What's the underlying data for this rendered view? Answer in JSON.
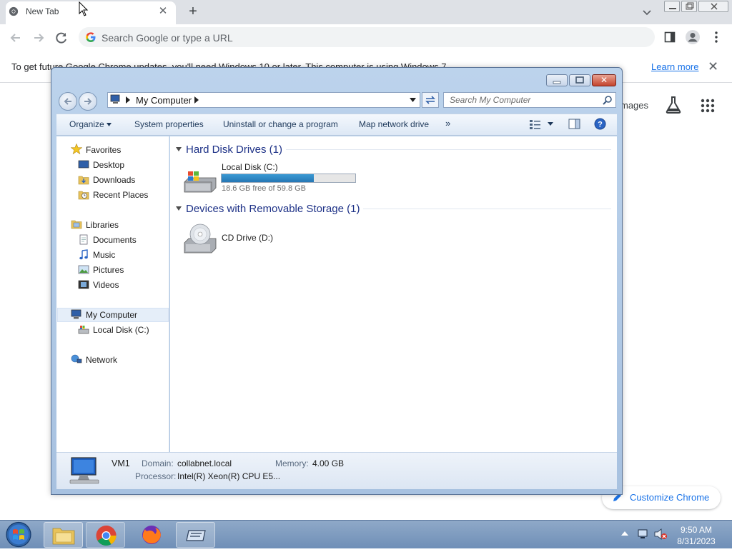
{
  "chrome": {
    "tab_title": "New Tab",
    "tab_close": "✕",
    "new_tab": "+",
    "omnibox_placeholder": "Search Google or type a URL",
    "infobar_text": "To get future Google Chrome updates, you'll need Windows 10 or later. This computer is using Windows 7.",
    "learn_more": "Learn more",
    "infobar_close": "✕",
    "images_link": "mages",
    "customize_label": "Customize Chrome"
  },
  "explorer": {
    "address_path": "My Computer",
    "search_placeholder": "Search My Computer",
    "close_glyph": "✕",
    "commands": [
      "Organize",
      "System properties",
      "Uninstall or change a program",
      "Map network drive",
      "»"
    ],
    "nav": {
      "favorites": "Favorites",
      "desktop": "Desktop",
      "downloads": "Downloads",
      "recent": "Recent Places",
      "libraries": "Libraries",
      "documents": "Documents",
      "music": "Music",
      "pictures": "Pictures",
      "videos": "Videos",
      "my_computer": "My Computer",
      "local_disk": "Local Disk (C:)",
      "network": "Network"
    },
    "groups": {
      "hdd_header": "Hard Disk Drives (1)",
      "removable_header": "Devices with Removable Storage (1)"
    },
    "drives": {
      "c_name": "Local Disk (C:)",
      "c_free": "18.6 GB free of 59.8 GB",
      "c_used_fraction": 0.69,
      "d_name": "CD Drive (D:)"
    },
    "details": {
      "computer_name": "VM1",
      "domain_label": "Domain:",
      "domain_value": "collabnet.local",
      "memory_label": "Memory:",
      "memory_value": "4.00 GB",
      "processor_label": "Processor:",
      "processor_value": "Intel(R) Xeon(R) CPU E5..."
    }
  },
  "taskbar": {
    "time": "9:50 AM",
    "date": "8/31/2023"
  },
  "colors": {
    "accent_blue": "#1a73e8",
    "disk_fill": "#2b86c6",
    "group_header": "#1e3287"
  }
}
